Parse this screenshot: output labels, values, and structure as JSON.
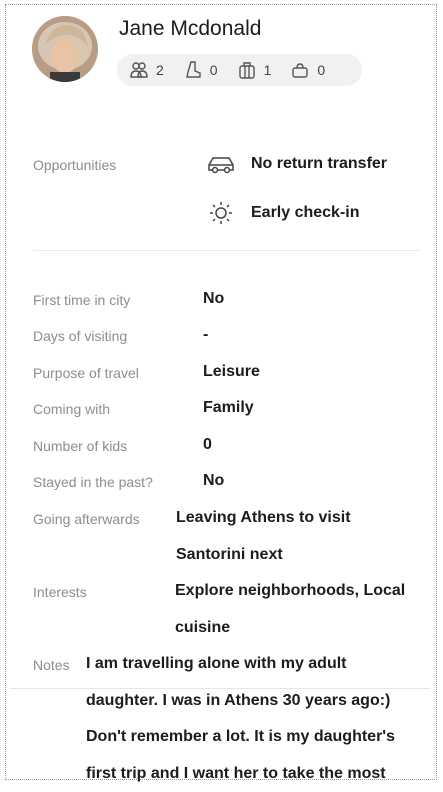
{
  "profile": {
    "name": "Jane Mcdonald",
    "stats": [
      {
        "icon": "group-icon",
        "value": "2"
      },
      {
        "icon": "boot-icon",
        "value": "0"
      },
      {
        "icon": "luggage-icon",
        "value": "1"
      },
      {
        "icon": "bag-icon",
        "value": "0"
      }
    ]
  },
  "opportunities": {
    "label": "Opportunities",
    "items": [
      {
        "icon": "car-icon",
        "text": "No return transfer"
      },
      {
        "icon": "sun-icon",
        "text": "Early check-in"
      }
    ]
  },
  "details": [
    {
      "label": "First time in city",
      "value": "No"
    },
    {
      "label": "Days of visiting",
      "value": "-"
    },
    {
      "label": "Purpose of travel",
      "value": "Leisure"
    },
    {
      "label": "Coming with",
      "value": "Family"
    },
    {
      "label": "Number of kids",
      "value": "0"
    },
    {
      "label": "Stayed in the past?",
      "value": "No"
    },
    {
      "label": "Going afterwards",
      "value_lines": [
        "Leaving Athens to visit",
        "Santorini next"
      ]
    },
    {
      "label": "Interests",
      "value_lines": [
        "Explore neighborhoods, Local",
        "cuisine"
      ]
    },
    {
      "label": "Notes",
      "value_lines": [
        "I am travelling alone with my adult",
        "daughter. I was in Athens 30 years ago:)",
        "Don't remember a lot. It is my daughter's",
        "first trip and I want her to take the most"
      ]
    }
  ]
}
